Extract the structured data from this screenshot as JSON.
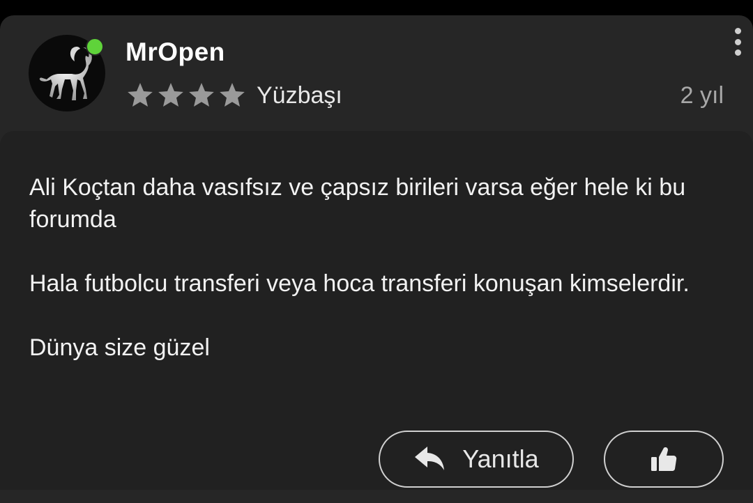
{
  "post": {
    "username": "MrOpen",
    "online": true,
    "rank_stars": 4,
    "rank": "Yüzbaşı",
    "time": "2 yıl",
    "paragraphs": [
      "Ali Koçtan daha vasıfsız ve çapsız birileri varsa eğer hele ki bu forumda",
      "Hala futbolcu transferi veya hoca transferi konuşan kimselerdir.",
      "Dünya size güzel"
    ]
  },
  "actions": {
    "reply_label": "Yanıtla"
  },
  "icons": {
    "avatar": "white-horse-avatar",
    "star": "star-icon",
    "menu": "more-vertical-icon",
    "reply": "reply-arrow-icon",
    "like": "thumbs-up-icon"
  },
  "colors": {
    "online": "#5fd33a",
    "stars": "#9a9a9a"
  }
}
